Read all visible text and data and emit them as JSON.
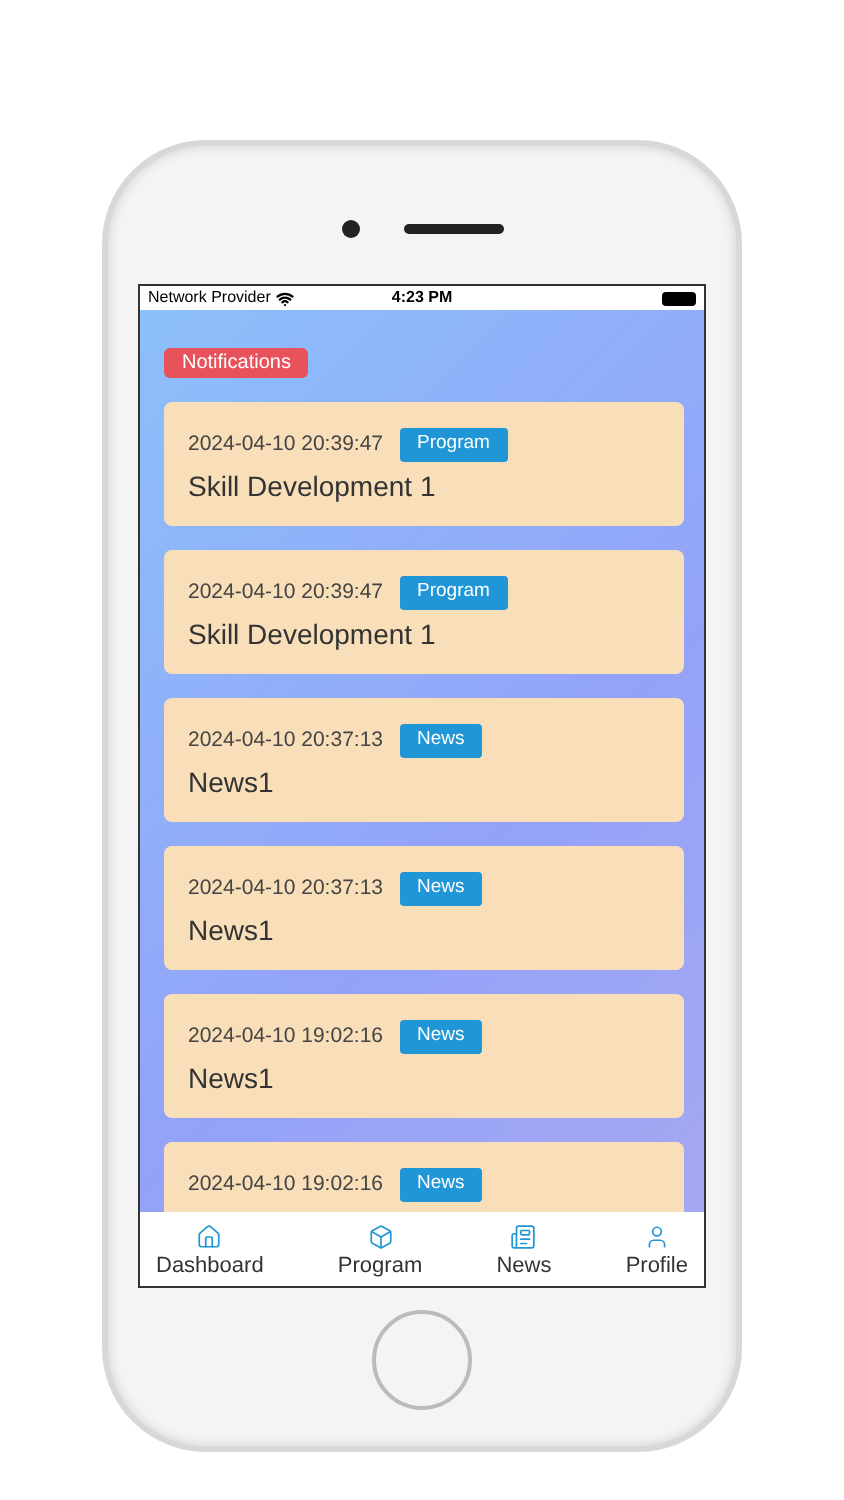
{
  "status_bar": {
    "carrier": "Network Provider",
    "time": "4:23 PM"
  },
  "header_badge": "Notifications",
  "notifications": [
    {
      "time": "2024-04-10 20:39:47",
      "tag": "Program",
      "title": "Skill Development 1"
    },
    {
      "time": "2024-04-10 20:39:47",
      "tag": "Program",
      "title": "Skill Development 1"
    },
    {
      "time": "2024-04-10 20:37:13",
      "tag": "News",
      "title": "News1"
    },
    {
      "time": "2024-04-10 20:37:13",
      "tag": "News",
      "title": "News1"
    },
    {
      "time": "2024-04-10 19:02:16",
      "tag": "News",
      "title": "News1"
    },
    {
      "time": "2024-04-10 19:02:16",
      "tag": "News"
    }
  ],
  "tab_bar": [
    {
      "kind": "home",
      "label": "Dashboard"
    },
    {
      "kind": "program",
      "label": "Program"
    },
    {
      "kind": "news",
      "label": "News"
    },
    {
      "kind": "profile",
      "label": "Profile"
    }
  ]
}
